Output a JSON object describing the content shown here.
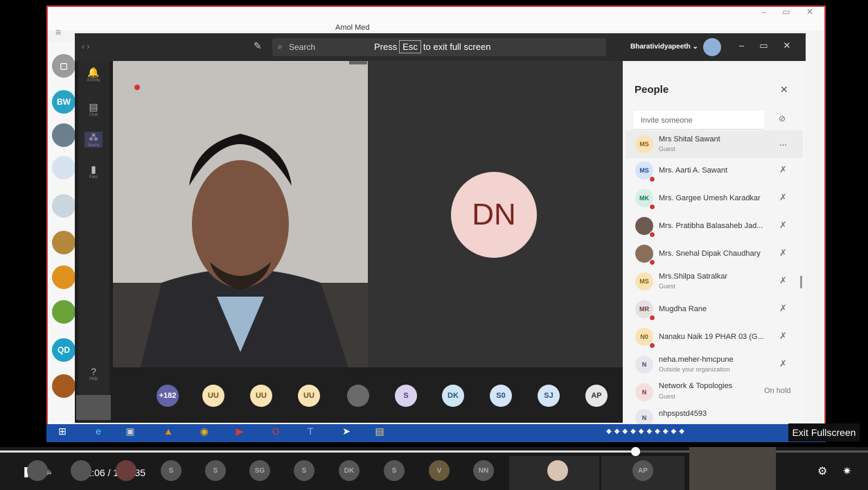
{
  "desktop": {
    "title": "Amol Med"
  },
  "teams": {
    "search_label": "Search",
    "fullscreen_press": "Press",
    "fullscreen_key": "Esc",
    "fullscreen_rest": "to exit full screen",
    "org_name": "Bharatividyapeeth",
    "rail": [
      {
        "label": "Activity"
      },
      {
        "label": "Chat"
      },
      {
        "label": "Teams"
      },
      {
        "label": "Files"
      },
      {
        "label": "Help"
      }
    ],
    "stage_initials": "DN",
    "strip_avatars": [
      "+182",
      "UU",
      "UU",
      "UU",
      "",
      "S",
      "DK",
      "S0",
      "SJ",
      "AP"
    ]
  },
  "people": {
    "title": "People",
    "invite_placeholder": "Invite someone",
    "rows": [
      {
        "initials": "MS",
        "name": "Mrs Shital Sawant",
        "sub": "Guest",
        "right": "..."
      },
      {
        "initials": "MS",
        "name": "Mrs. Aarti A. Sawant",
        "sub": "",
        "right": ""
      },
      {
        "initials": "MK",
        "name": "Mrs. Gargee Umesh Karadkar",
        "sub": "",
        "right": ""
      },
      {
        "initials": "",
        "name": "Mrs. Pratibha Balasaheb Jad...",
        "sub": "",
        "right": ""
      },
      {
        "initials": "",
        "name": "Mrs. Snehal Dipak Chaudhary",
        "sub": "",
        "right": ""
      },
      {
        "initials": "MS",
        "name": "Mrs.Shilpa Satralkar",
        "sub": "Guest",
        "right": ""
      },
      {
        "initials": "MR",
        "name": "Mugdha Rane",
        "sub": "",
        "right": ""
      },
      {
        "initials": "N0",
        "name": "Nanaku Naik 19 PHAR 03 (G...",
        "sub": "",
        "right": ""
      },
      {
        "initials": "N",
        "name": "neha.meher-hmcpune",
        "sub": "Outside your organization",
        "right": ""
      },
      {
        "initials": "N",
        "name": "Network & Topologies",
        "sub": "Guest",
        "right": "On hold"
      },
      {
        "initials": "N",
        "name": "nhpspstd4593",
        "sub": "",
        "right": ""
      }
    ]
  },
  "left_strip": [
    "BW",
    "QD"
  ],
  "overlay": {
    "exit_fullscreen": "Exit Fullscreen"
  },
  "player": {
    "time": "1:21:06 / 1:50:35",
    "progress_fraction": 0.733,
    "avatars": [
      "",
      "",
      "",
      "S",
      "S",
      "SG",
      "S",
      "DK",
      "S",
      "V",
      "NN",
      "",
      "AP"
    ]
  }
}
